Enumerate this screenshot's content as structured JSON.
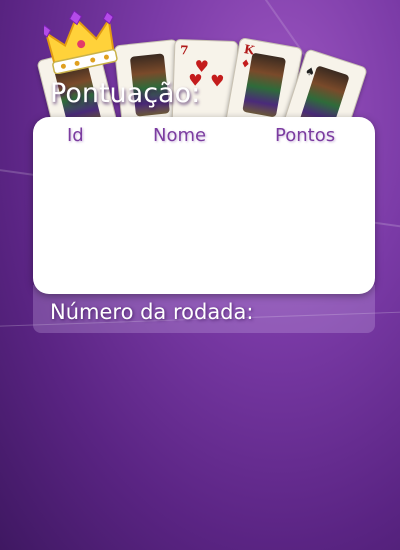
{
  "header": {
    "title": "Pontuação:"
  },
  "cards": [
    {
      "rank": "",
      "suit": "♦"
    },
    {
      "rank": "7",
      "suit": "♥"
    },
    {
      "rank": "K",
      "suit": "♦"
    },
    {
      "rank": "",
      "suit": "♠"
    }
  ],
  "scoreboard": {
    "columns": {
      "id": "Id",
      "name": "Nome",
      "points": "Pontos"
    },
    "rows": []
  },
  "round": {
    "label": "Número da rodada:"
  }
}
